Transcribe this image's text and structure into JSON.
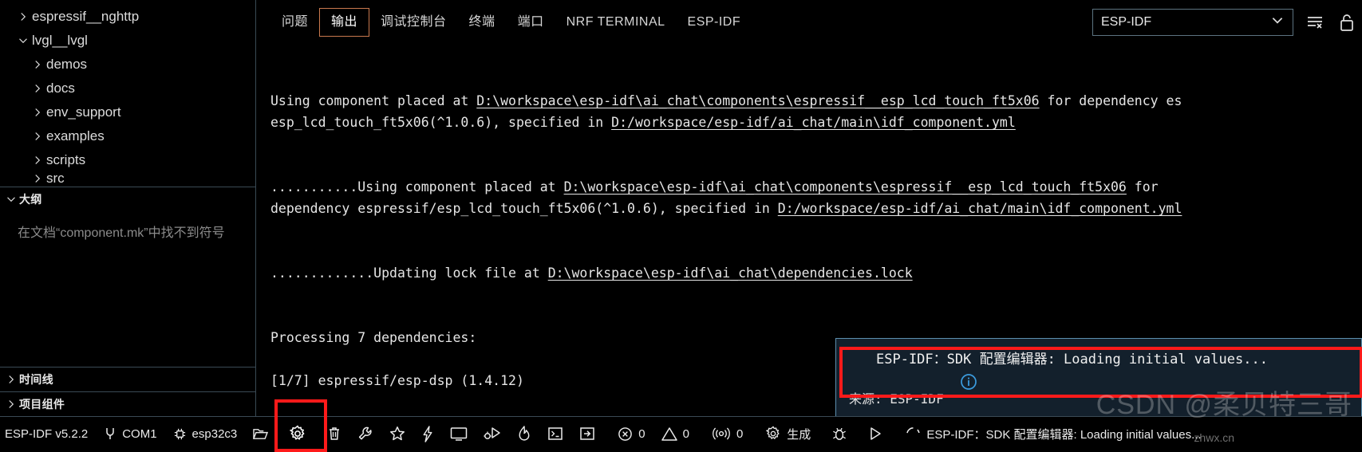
{
  "sidebar": {
    "tree_items": [
      {
        "label": "espressif__nghttp",
        "icon": "chevron-right-icon",
        "indent": 0,
        "expanded": false
      },
      {
        "label": "lvgl__lvgl",
        "icon": "chevron-down-icon",
        "indent": 0,
        "expanded": true
      },
      {
        "label": "demos",
        "icon": "chevron-right-icon",
        "indent": 1,
        "expanded": false
      },
      {
        "label": "docs",
        "icon": "chevron-right-icon",
        "indent": 1,
        "expanded": false
      },
      {
        "label": "env_support",
        "icon": "chevron-right-icon",
        "indent": 1,
        "expanded": false
      },
      {
        "label": "examples",
        "icon": "chevron-right-icon",
        "indent": 1,
        "expanded": false
      },
      {
        "label": "scripts",
        "icon": "chevron-right-icon",
        "indent": 1,
        "expanded": false
      },
      {
        "label": "src",
        "icon": "chevron-right-icon",
        "indent": 1,
        "expanded": false
      }
    ],
    "outline": {
      "title": "大纲",
      "message": "在文档“component.mk”中找不到符号"
    },
    "timeline": {
      "title": "时间线"
    },
    "project_components": {
      "title": "项目组件"
    }
  },
  "panel": {
    "tabs": [
      {
        "label": "问题",
        "selected": false
      },
      {
        "label": "输出",
        "selected": true
      },
      {
        "label": "调试控制台",
        "selected": false
      },
      {
        "label": "终端",
        "selected": false
      },
      {
        "label": "端口",
        "selected": false
      },
      {
        "label": "NRF TERMINAL",
        "selected": false
      },
      {
        "label": "ESP-IDF",
        "selected": false
      }
    ],
    "channel_select": {
      "value": "ESP-IDF",
      "icon": "chevron-down-icon"
    },
    "actions": [
      {
        "name": "clear-output-icon",
        "label": "清除输出"
      },
      {
        "name": "unlock-icon",
        "label": "解除锁定"
      }
    ]
  },
  "output": {
    "lines": [
      [
        {
          "t": "Using component placed at ",
          "u": false
        },
        {
          "t": "D:\\workspace\\esp-idf\\ai_chat\\components\\espressif__esp_lcd_touch_ft5x06",
          "u": true
        },
        {
          "t": " for dependency es",
          "u": false
        }
      ],
      [
        {
          "t": "esp_lcd_touch_ft5x06(^1.0.6), specified in ",
          "u": false
        },
        {
          "t": "D:/workspace/esp-idf/ai_chat/main\\idf_component.yml",
          "u": true
        }
      ],
      [],
      [],
      [
        {
          "t": "...........Using component placed at ",
          "u": false
        },
        {
          "t": "D:\\workspace\\esp-idf\\ai_chat\\components\\espressif__esp_lcd_touch_ft5x06",
          "u": true
        },
        {
          "t": " for",
          "u": false
        }
      ],
      [
        {
          "t": "dependency espressif/esp_lcd_touch_ft5x06(^1.0.6), specified in ",
          "u": false
        },
        {
          "t": "D:/workspace/esp-idf/ai_chat/main\\idf_component.yml",
          "u": true
        }
      ],
      [],
      [],
      [
        {
          "t": ".............Updating lock file at ",
          "u": false
        },
        {
          "t": "D:\\workspace\\esp-idf\\ai_chat\\dependencies.lock",
          "u": true
        }
      ],
      [],
      [],
      [
        {
          "t": "Processing 7 dependencies:",
          "u": false
        }
      ],
      [],
      [
        {
          "t": "[1/7] espressif/esp-dsp (1.4.12)",
          "u": false
        }
      ]
    ]
  },
  "notification": {
    "icon": "info-icon",
    "message": "ESP-IDF：SDK 配置编辑器: Loading initial values...",
    "source_label": "来源: ESP-IDF",
    "highlight_color": "#ff1a1a"
  },
  "statusbar": {
    "items": [
      {
        "name": "esp-idf-version",
        "icon": null,
        "label": "ESP-IDF v5.2.2"
      },
      {
        "name": "serial-port",
        "icon": "plug-icon",
        "label": "COM1"
      },
      {
        "name": "target-chip",
        "icon": "chip-icon",
        "label": "esp32c3"
      },
      {
        "name": "open-folder",
        "icon": "folder-open-icon",
        "label": ""
      },
      {
        "name": "sdk-configuration-editor",
        "icon": "gear-icon",
        "label": "",
        "highlighted": true
      },
      {
        "name": "full-clean",
        "icon": "trash-icon",
        "label": ""
      },
      {
        "name": "build-project",
        "icon": "wrench-icon",
        "label": ""
      },
      {
        "name": "favorites",
        "icon": "star-icon",
        "label": ""
      },
      {
        "name": "flash-device",
        "icon": "lightning-icon",
        "label": ""
      },
      {
        "name": "monitor-device",
        "icon": "monitor-icon",
        "label": ""
      },
      {
        "name": "debug-device",
        "icon": "debug-run-icon",
        "label": ""
      },
      {
        "name": "erase-flash",
        "icon": "flame-icon",
        "label": ""
      },
      {
        "name": "open-terminal",
        "icon": "terminal-icon",
        "label": ""
      },
      {
        "name": "open-external",
        "icon": "arrow-box-icon",
        "label": ""
      },
      {
        "name": "error-count",
        "icon": "error-circle-icon",
        "label": "0"
      },
      {
        "name": "warning-count",
        "icon": "warning-triangle-icon",
        "label": "0"
      },
      {
        "name": "radio-count",
        "icon": "radio-tower-icon",
        "label": "0"
      },
      {
        "name": "build-task",
        "icon": "gear-icon",
        "label": "生成"
      },
      {
        "name": "bug-report",
        "icon": "bug-icon",
        "label": ""
      },
      {
        "name": "run-task",
        "icon": "play-icon",
        "label": ""
      },
      {
        "name": "progress-status",
        "icon": "spinner-icon",
        "label": "ESP-IDF：SDK 配置编辑器: Loading initial values..."
      }
    ]
  },
  "watermark": {
    "text": "CSDN @柔贝特三哥",
    "sub": "zhwx.cn"
  },
  "colors": {
    "accent_border": "#5c8fae",
    "tab_selected_border": "#c9794e",
    "highlight_red": "#ff1a1a",
    "background": "#000000",
    "toast_background": "#13202c"
  }
}
